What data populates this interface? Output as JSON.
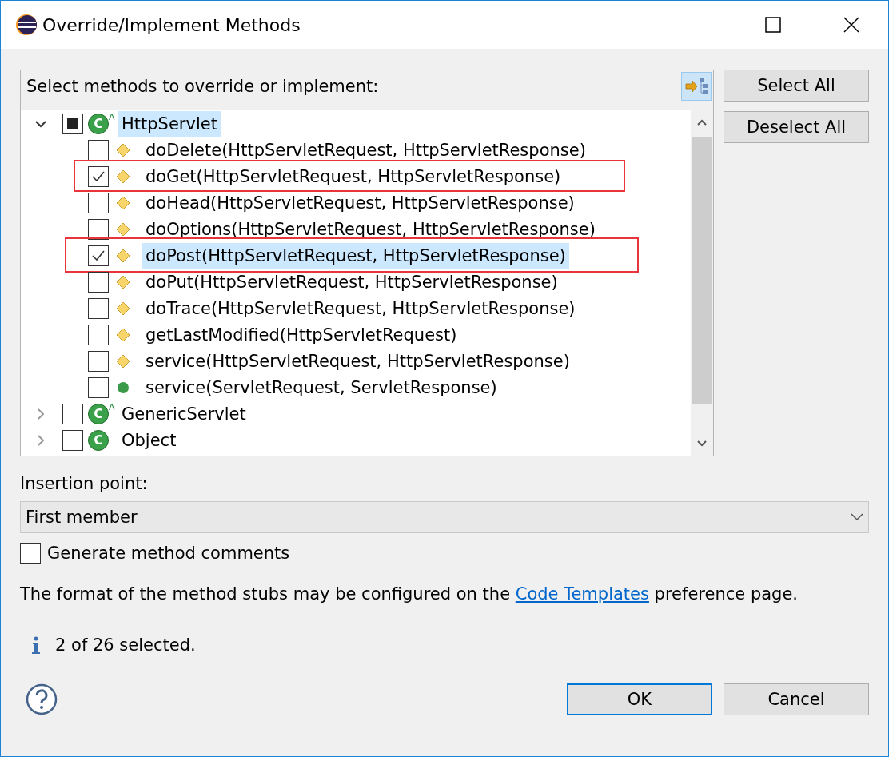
{
  "window": {
    "title": "Override/Implement Methods"
  },
  "tree": {
    "heading": "Select methods to override or implement:",
    "nodes": [
      {
        "label": "HttpServlet",
        "expanded": true,
        "checked": false,
        "partial": true,
        "selected": true,
        "type_mark": "C",
        "modifier": "A",
        "children": [
          {
            "label": "doDelete(HttpServletRequest, HttpServletResponse)",
            "kind": "protected",
            "checked": false,
            "selected": false,
            "framed": false
          },
          {
            "label": "doGet(HttpServletRequest, HttpServletResponse)",
            "kind": "protected",
            "checked": true,
            "selected": false,
            "framed": true
          },
          {
            "label": "doHead(HttpServletRequest, HttpServletResponse)",
            "kind": "protected",
            "checked": false,
            "selected": false,
            "framed": false
          },
          {
            "label": "doOptions(HttpServletRequest, HttpServletResponse)",
            "kind": "protected",
            "checked": false,
            "selected": false,
            "framed": false
          },
          {
            "label": "doPost(HttpServletRequest, HttpServletResponse)",
            "kind": "protected",
            "checked": true,
            "selected": true,
            "framed": true
          },
          {
            "label": "doPut(HttpServletRequest, HttpServletResponse)",
            "kind": "protected",
            "checked": false,
            "selected": false,
            "framed": false
          },
          {
            "label": "doTrace(HttpServletRequest, HttpServletResponse)",
            "kind": "protected",
            "checked": false,
            "selected": false,
            "framed": false
          },
          {
            "label": "getLastModified(HttpServletRequest)",
            "kind": "protected",
            "checked": false,
            "selected": false,
            "framed": false
          },
          {
            "label": "service(HttpServletRequest, HttpServletResponse)",
            "kind": "protected",
            "checked": false,
            "selected": false,
            "framed": false
          },
          {
            "label": "service(ServletRequest, ServletResponse)",
            "kind": "public",
            "checked": false,
            "selected": false,
            "framed": false
          }
        ]
      },
      {
        "label": "GenericServlet",
        "expanded": false,
        "checked": false,
        "partial": false,
        "selected": false,
        "type_mark": "C",
        "modifier": "A"
      },
      {
        "label": "Object",
        "expanded": false,
        "checked": false,
        "partial": false,
        "selected": false,
        "type_mark": "C"
      }
    ]
  },
  "side_buttons": [
    "Select All",
    "Deselect All"
  ],
  "insertion": {
    "label": "Insertion point:",
    "value": "First member"
  },
  "comments": {
    "label": "Generate method comments",
    "checked": false
  },
  "note": {
    "before": "The format of the method stubs may be configured on the ",
    "link": "Code Templates",
    "after": " preference page."
  },
  "status": "2 of 26 selected.",
  "buttons": {
    "ok": "OK",
    "cancel": "Cancel"
  }
}
